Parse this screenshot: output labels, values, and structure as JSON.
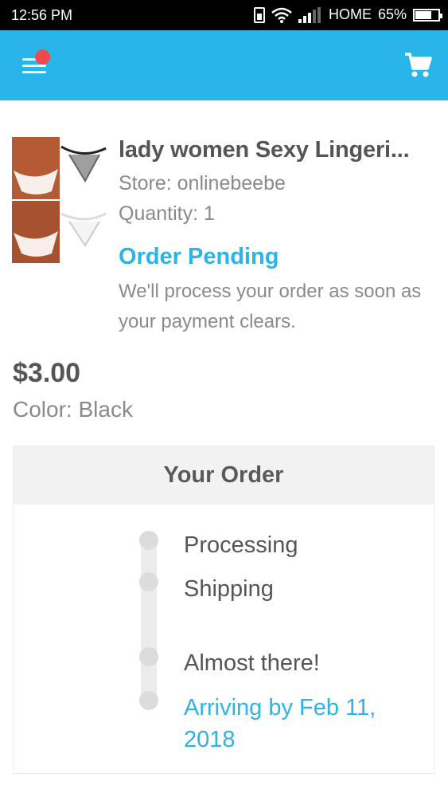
{
  "status_bar": {
    "time": "12:56 PM",
    "carrier": "HOME",
    "battery": "65%"
  },
  "app_bar": {
    "menu_icon": "hamburger-menu-icon",
    "notification_dot_color": "#ef4a4a",
    "cart_icon": "shopping-cart-icon",
    "background_color": "#29b5ea"
  },
  "product": {
    "title": "lady women Sexy Lingeri...",
    "store": "Store: onlinebeebe",
    "quantity": "Quantity: 1",
    "status": "Order Pending",
    "status_description": "We'll process your order as soon as your payment clears.",
    "price": "$3.00",
    "color": "Color: Black"
  },
  "order": {
    "header": "Your Order",
    "steps": [
      "Processing",
      "Shipping",
      "Almost there!",
      "Arriving by Feb 11, 2018"
    ]
  }
}
